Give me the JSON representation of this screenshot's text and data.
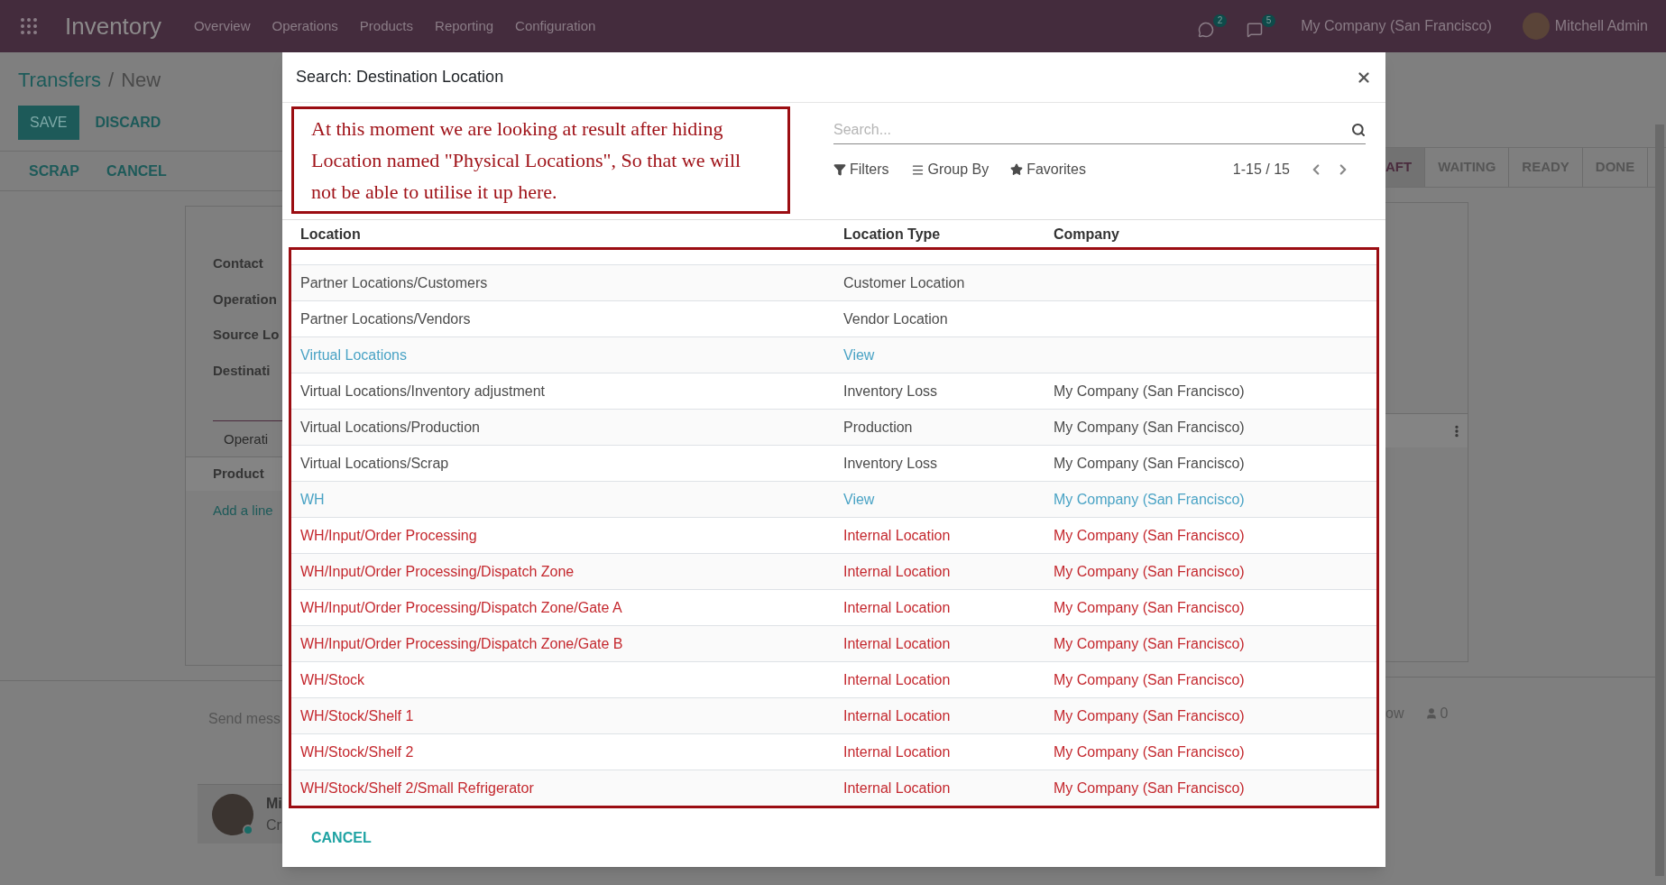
{
  "navbar": {
    "app_title": "Inventory",
    "menu": [
      "Overview",
      "Operations",
      "Products",
      "Reporting",
      "Configuration"
    ],
    "messages_count": "2",
    "activities_count": "5",
    "company": "My Company (San Francisco)",
    "user": "Mitchell Admin"
  },
  "form_view": {
    "breadcrumb": [
      "Transfers",
      "New"
    ],
    "breadcrumb_separator": "/",
    "buttons": [
      "SAVE",
      "DISCARD"
    ],
    "actions": [
      "SCRAP",
      "CANCEL"
    ],
    "status_stages": [
      {
        "label": "AFT",
        "selected": true
      },
      {
        "label": "WAITING",
        "selected": false
      },
      {
        "label": "READY",
        "selected": false
      },
      {
        "label": "DONE",
        "selected": false
      }
    ],
    "fields": [
      "Contact",
      "Operation",
      "Source Lo",
      "Destinati"
    ],
    "tab": "Operati",
    "product_header": "Product",
    "add_line": "Add a line",
    "chatter": {
      "send_message": "Send mess",
      "follow": "ow",
      "followers": "0",
      "author": "Mi",
      "message": "Cr"
    }
  },
  "dialog": {
    "title": "Search: Destination Location",
    "annotation": "At this moment we are looking at result after hiding Location named \"Physical Locations\", So that we will not be able to utilise it up here.",
    "search": {
      "placeholder": "Search..."
    },
    "filters": [
      {
        "kind": "filter",
        "label": "Filters"
      },
      {
        "kind": "group",
        "label": "Group By"
      },
      {
        "kind": "favorite",
        "label": "Favorites"
      }
    ],
    "pager": "1-15 / 15",
    "columns": [
      "Location",
      "Location Type",
      "Company"
    ],
    "rows": [
      {
        "location": "Partner Locations/Customers",
        "type": "Customer Location",
        "color": "#4c4c4c"
      },
      {
        "location": "Partner Locations/Vendors",
        "type": "Vendor Location",
        "color": "#4c4c4c"
      },
      {
        "location": "Virtual Locations",
        "type": "View",
        "color": "#4aa3c5"
      },
      {
        "location": "Virtual Locations/Inventory adjustment",
        "type": "Inventory Loss",
        "company": "My Company (San Francisco)",
        "color": "#4c4c4c"
      },
      {
        "location": "Virtual Locations/Production",
        "type": "Production",
        "company": "My Company (San Francisco)",
        "color": "#4c4c4c"
      },
      {
        "location": "Virtual Locations/Scrap",
        "type": "Inventory Loss",
        "company": "My Company (San Francisco)",
        "color": "#4c4c4c"
      },
      {
        "location": "WH",
        "type": "View",
        "company": "My Company (San Francisco)",
        "color": "#4aa3c5"
      },
      {
        "location": "WH/Input/Order Processing",
        "type": "Internal Location",
        "company": "My Company (San Francisco)",
        "color": "#c4282e"
      },
      {
        "location": "WH/Input/Order Processing/Dispatch Zone",
        "type": "Internal Location",
        "company": "My Company (San Francisco)",
        "color": "#c4282e"
      },
      {
        "location": "WH/Input/Order Processing/Dispatch Zone/Gate A",
        "type": "Internal Location",
        "company": "My Company (San Francisco)",
        "color": "#c4282e"
      },
      {
        "location": "WH/Input/Order Processing/Dispatch Zone/Gate B",
        "type": "Internal Location",
        "company": "My Company (San Francisco)",
        "color": "#c4282e"
      },
      {
        "location": "WH/Stock",
        "type": "Internal Location",
        "company": "My Company (San Francisco)",
        "color": "#c4282e"
      },
      {
        "location": "WH/Stock/Shelf 1",
        "type": "Internal Location",
        "company": "My Company (San Francisco)",
        "color": "#c4282e"
      },
      {
        "location": "WH/Stock/Shelf 2",
        "type": "Internal Location",
        "company": "My Company (San Francisco)",
        "color": "#c4282e"
      },
      {
        "location": "WH/Stock/Shelf 2/Small Refrigerator",
        "type": "Internal Location",
        "company": "My Company (San Francisco)",
        "color": "#c4282e"
      }
    ],
    "cancel": "CANCEL"
  }
}
